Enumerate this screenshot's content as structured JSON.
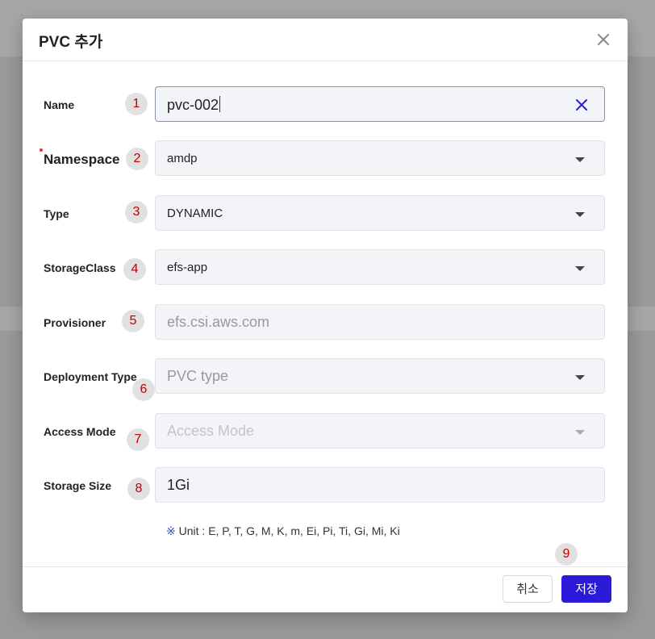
{
  "dialog": {
    "title": "PVC 추가",
    "fields": {
      "name": {
        "label": "Name",
        "value": "pvc-002",
        "badge": "1"
      },
      "namespace": {
        "label": "Namespace",
        "value": "amdp",
        "badge": "2",
        "required": true
      },
      "type": {
        "label": "Type",
        "value": "DYNAMIC",
        "badge": "3"
      },
      "storage_class": {
        "label": "StorageClass",
        "value": "efs-app",
        "badge": "4"
      },
      "provisioner": {
        "label": "Provisioner",
        "value": "efs.csi.aws.com",
        "badge": "5"
      },
      "deployment_type": {
        "label": "Deployment Type",
        "placeholder": "PVC type",
        "badge": "6"
      },
      "access_mode": {
        "label": "Access Mode",
        "placeholder": "Access Mode",
        "badge": "7",
        "disabled": true
      },
      "storage_size": {
        "label": "Storage Size",
        "value": "1Gi",
        "badge": "8"
      }
    },
    "unit_hint_mark": "※",
    "unit_hint": "Unit : E, P, T, G, M, K, m, Ei, Pi, Ti, Gi, Mi, Ki",
    "footer_badge": "9",
    "buttons": {
      "cancel": "취소",
      "save": "저장"
    }
  },
  "colors": {
    "primary": "#2b1ad9",
    "badge_text": "#c00000",
    "required": "#e53935"
  }
}
